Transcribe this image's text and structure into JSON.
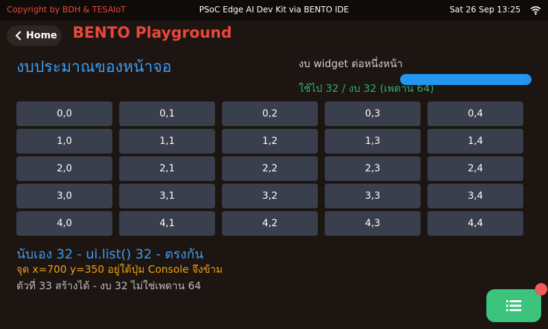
{
  "statusbar": {
    "copyright": "Copyright by BDH & TESAIoT",
    "device": "PSoC Edge AI Dev Kit via BENTO IDE",
    "datetime": "Sat 26 Sep 13:25",
    "wifi_icon": "wifi-icon"
  },
  "header": {
    "home_label": "Home",
    "title": "BENTO Playground"
  },
  "main": {
    "section_title": "งบประมาณของหน้าจอ",
    "widget_label": "งบ widget ต่อหนึ่งหน้า",
    "usage_text": "ใช้ไป 32 / งบ 32 (เพดาน 64)",
    "usage_fraction": 1.0,
    "grid": [
      [
        "0,0",
        "0,1",
        "0,2",
        "0,3",
        "0,4"
      ],
      [
        "1,0",
        "1,1",
        "1,2",
        "1,3",
        "1,4"
      ],
      [
        "2,0",
        "2,1",
        "2,2",
        "2,3",
        "2,4"
      ],
      [
        "3,0",
        "3,1",
        "3,2",
        "3,3",
        "3,4"
      ],
      [
        "4,0",
        "4,1",
        "4,2",
        "4,3",
        "4,4"
      ]
    ],
    "summary": "นับเอง 32 - ui.list() 32 - ตรงกัน",
    "position_text": "จุด x=700 y=350 อยู่ใต้ปุ่ม Console จึงข้าม",
    "note_text": "ตัวที่ 33 สร้างได้ - งบ 32 ไม่ใช่เพดาน 64"
  },
  "console": {
    "icon": "list-icon"
  },
  "colors": {
    "accent_red": "#e8483a",
    "accent_blue": "#3d9cf0",
    "accent_green": "#27b36a",
    "accent_orange": "#f0a015",
    "bar_blue": "#2196f3",
    "button_green": "#3cc47c"
  }
}
